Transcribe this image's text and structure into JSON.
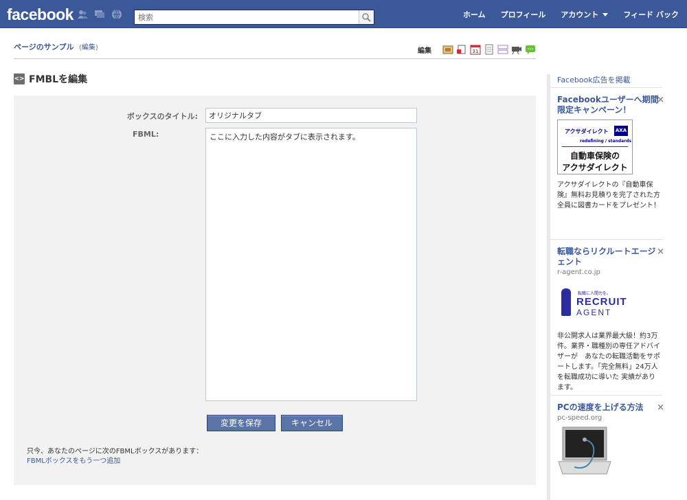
{
  "topbar": {
    "logo": "facebook",
    "search_placeholder": "検索",
    "nav": [
      "ホーム",
      "プロフィール",
      "アカウント",
      "フィード バック"
    ]
  },
  "page_header": {
    "name": "ページのサンプル",
    "edit_open": "(",
    "edit_link": "編集",
    "edit_close": ")",
    "tools_label": "編集"
  },
  "section": {
    "title": "FMBLを編集",
    "icon_text": "<>"
  },
  "form": {
    "title_label": "ボックスのタイトル:",
    "title_value": "オリジナルタブ",
    "fbml_label": "FBML:",
    "fbml_value": "ここに入力した内容がタブに表示されます。",
    "save_button": "変更を保存",
    "cancel_button": "キャンセル",
    "info_text": "只今、あなたのページに次のFBMLボックスがあります：",
    "add_link": "FBMLボックスをもう一つ追加"
  },
  "sidebar": {
    "create_ad": "Facebook広告を掲載",
    "close_glyph": "×",
    "ads": [
      {
        "title": "Facebookユーザーへ期間限定キャンペーン！",
        "url": "",
        "body": "アクサダイレクトの『自動車保険』無料お見積りを完了された方全員に図書カードをプレゼント！",
        "image_text": {
          "brand": "アクサダイレクト",
          "mark": "AXA",
          "tagline": "redefining / standards",
          "line1": "自動車保険の",
          "line2": "アクサダイレクト"
        }
      },
      {
        "title": "転職ならリクルートエージェント",
        "url": "r-agent.co.jp",
        "body": "非公開求人は業界最大級！約3万件。業界・職種別の専任アドバイザーが　あなたの転職活動をサポートします。「完全無料」24万人を転職成功に導いた 実績があります。",
        "image_text": {
          "small": "転職に人間力を。",
          "line1": "RECRUIT",
          "line2": "AGENT"
        }
      },
      {
        "title": "PCの速度を上げる方法",
        "url": "pc-speed.org",
        "body": ""
      }
    ]
  },
  "colors": {
    "brand_blue": "#3b5998",
    "panel_gray": "#f2f2f2",
    "button_blue": "#5b74a8"
  },
  "icons": [
    "friends-icon",
    "messages-icon",
    "notifications-icon",
    "search-icon",
    "fbml-icon",
    "tool-icons"
  ]
}
